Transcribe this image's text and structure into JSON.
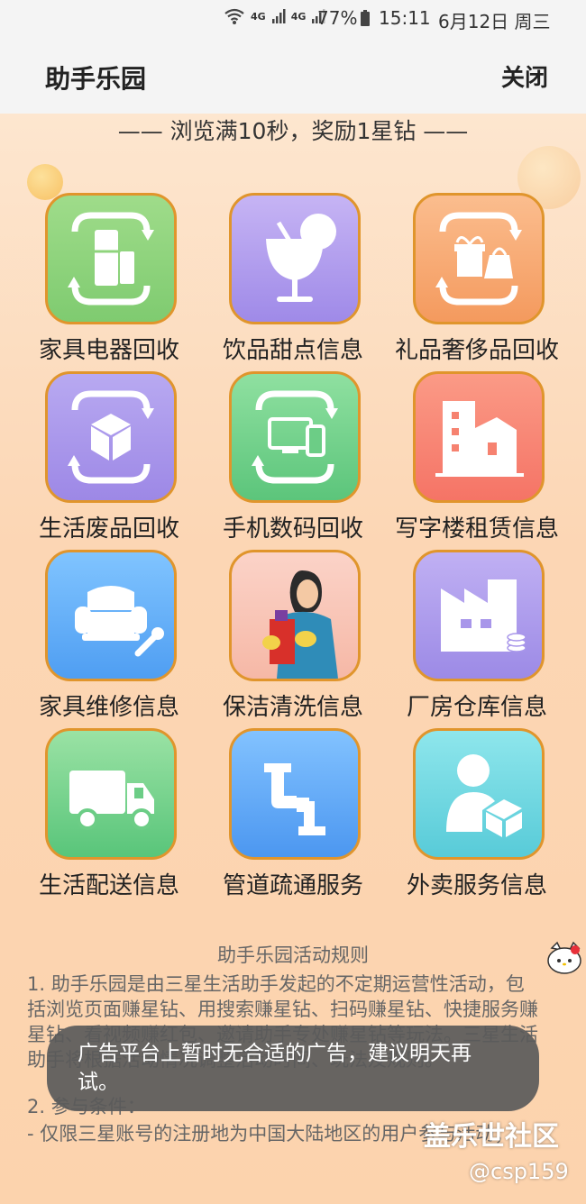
{
  "status_bar": {
    "wifi_icon": "wifi-icon",
    "signal1_label": "4G",
    "signal2_label": "4G",
    "battery_percent": "77%",
    "time": "15:11",
    "date": "6月12日 周三"
  },
  "header": {
    "title": "助手乐园",
    "close_label": "关闭"
  },
  "notice": "—— 浏览满10秒，奖励1星钻 ——",
  "services": [
    {
      "label": "家具电器回收",
      "icon": "fridge-recycle-icon",
      "color_top": "#9fdc8a",
      "color_bottom": "#7fcb70"
    },
    {
      "label": "饮品甜点信息",
      "icon": "drink-icon",
      "color_top": "#c6b4f4",
      "color_bottom": "#9f8ae8"
    },
    {
      "label": "礼品奢侈品回收",
      "icon": "gift-recycle-icon",
      "color_top": "#fbbd8e",
      "color_bottom": "#f49a5e"
    },
    {
      "label": "生活废品回收",
      "icon": "box-recycle-icon",
      "color_top": "#b8a9f1",
      "color_bottom": "#9d88e6"
    },
    {
      "label": "手机数码回收",
      "icon": "device-recycle-icon",
      "color_top": "#8fe0a0",
      "color_bottom": "#5cc57b"
    },
    {
      "label": "写字楼租赁信息",
      "icon": "office-building-icon",
      "color_top": "#fb9a86",
      "color_bottom": "#f57466"
    },
    {
      "label": "家具维修信息",
      "icon": "sofa-repair-icon",
      "color_top": "#80c4ff",
      "color_bottom": "#4f9ef2"
    },
    {
      "label": "保洁清洗信息",
      "icon": "cleaner-icon",
      "color_top": "#fbd3c8",
      "color_bottom": "#f6b8a6"
    },
    {
      "label": "厂房仓库信息",
      "icon": "factory-icon",
      "color_top": "#c0b0f3",
      "color_bottom": "#9c8ae6"
    },
    {
      "label": "生活配送信息",
      "icon": "truck-icon",
      "color_top": "#9ae2a4",
      "color_bottom": "#59c57a"
    },
    {
      "label": "管道疏通服务",
      "icon": "pipe-icon",
      "color_top": "#82c2ff",
      "color_bottom": "#4c97f0"
    },
    {
      "label": "外卖服务信息",
      "icon": "delivery-person-icon",
      "color_top": "#8ee6ec",
      "color_bottom": "#58cbd8"
    }
  ],
  "rules": {
    "title": "助手乐园活动规则",
    "item1": "1. 助手乐园是由三星生活助手发起的不定期运营性活动，包括浏览页面赚星钻、用搜索赚星钻、扫码赚星钻、快捷服务赚星钻、看视频赚红包、邀请助手专处赚星钻等玩法。三星生活助手将根据活动情况调整活动时间、玩法及规则。",
    "item2_title": "2. 参与条件：",
    "item2_body": "- 仅限三星账号的注册地为中国大陆地区的用户参与活动；"
  },
  "toast": "广告平台上暂时无合适的广告，建议明天再试。",
  "watermark": {
    "site": "盖乐世社区",
    "user": "@csp159"
  }
}
